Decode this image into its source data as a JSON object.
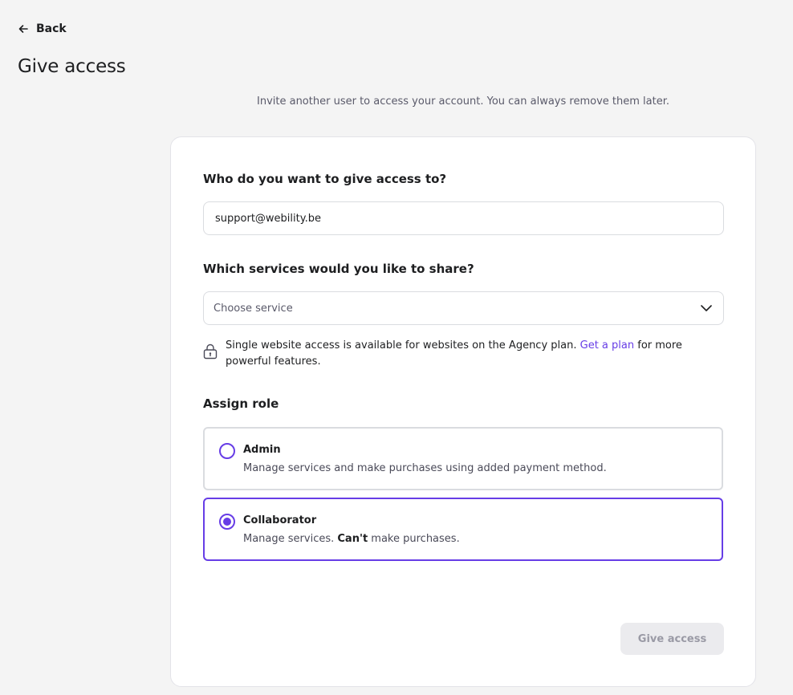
{
  "header": {
    "back_label": "Back",
    "title": "Give access",
    "subtitle": "Invite another user to access your account. You can always remove them later."
  },
  "form": {
    "email_label": "Who do you want to give access to?",
    "email_value": "support@webility.be",
    "services_label": "Which services would you like to share?",
    "services_placeholder": "Choose service",
    "notice_text": "Single website access is available for websites on the Agency plan.",
    "notice_link": "Get a plan",
    "notice_suffix": "for more powerful features.",
    "role_label": "Assign role",
    "roles": [
      {
        "title": "Admin",
        "description": "Manage services and make purchases using added payment method.",
        "selected": false
      },
      {
        "title": "Collaborator",
        "description_prefix": "Manage services.",
        "description_emphasis": "Can't",
        "description_suffix": "make purchases.",
        "selected": true
      }
    ],
    "submit_label": "Give access"
  },
  "colors": {
    "accent": "#673de6",
    "background": "#f4f4f4",
    "disabled_button": "#ebebee"
  },
  "icons": {
    "back": "arrow-left-icon",
    "dropdown": "chevron-down-icon",
    "notice": "lock-icon"
  }
}
